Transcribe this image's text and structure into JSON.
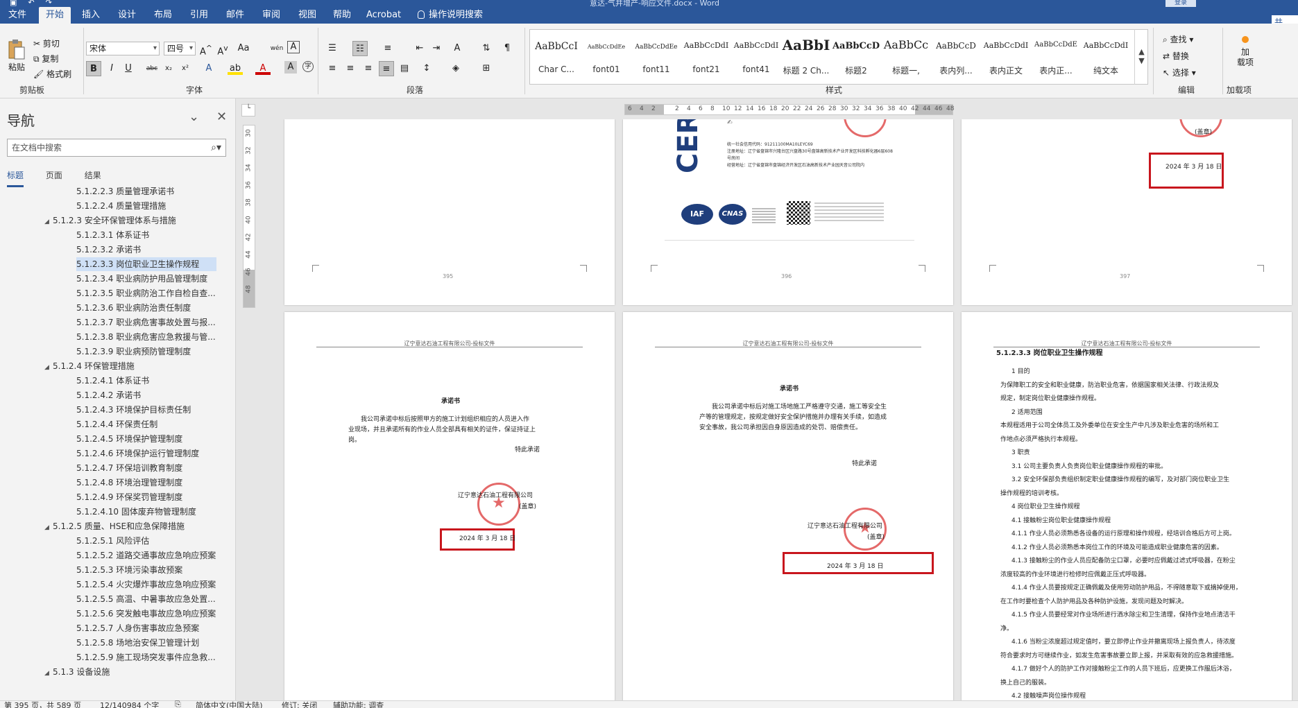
{
  "window": {
    "title": "意达-气井增产-响应文件.docx  -  Word",
    "login_label": "登录"
  },
  "menu": {
    "tabs": [
      {
        "label": "文件"
      },
      {
        "label": "开始"
      },
      {
        "label": "插入"
      },
      {
        "label": "设计"
      },
      {
        "label": "布局"
      },
      {
        "label": "引用"
      },
      {
        "label": "邮件"
      },
      {
        "label": "审阅"
      },
      {
        "label": "视图"
      },
      {
        "label": "帮助"
      },
      {
        "label": "Acrobat"
      }
    ],
    "tell_me": "操作说明搜索",
    "share": "共"
  },
  "ribbon": {
    "clipboard": {
      "paste": "粘贴",
      "cut": "剪切",
      "copy": "复制",
      "format_painter": "格式刷",
      "group": "剪贴板"
    },
    "font": {
      "name": "宋体",
      "size": "四号",
      "group": "字体",
      "case_btn": "Aa",
      "phonetic": "wén",
      "border_char": "A"
    },
    "paragraph": {
      "group": "段落"
    },
    "styles": {
      "group": "样式",
      "items": [
        {
          "preview": "AaBbCcI",
          "name": "Char C..."
        },
        {
          "preview": "AaBbCcDdEe",
          "name": "font01"
        },
        {
          "preview": "AaBbCcDdEe",
          "name": "font11"
        },
        {
          "preview": "AaBbCcDdI",
          "name": "font21"
        },
        {
          "preview": "AaBbCcDdI",
          "name": "font41"
        },
        {
          "preview": "AaBbI",
          "name": "标题 2 Ch..."
        },
        {
          "preview": "AaBbCcD",
          "name": "标题2"
        },
        {
          "preview": "AaBbCc",
          "name": "标题一,"
        },
        {
          "preview": "AaBbCcD",
          "name": "表内列..."
        },
        {
          "preview": "AaBbCcDdI",
          "name": "表内正文"
        },
        {
          "preview": "AaBbCcDdE",
          "name": "表内正..."
        },
        {
          "preview": "AaBbCcDdI",
          "name": "纯文本"
        }
      ]
    },
    "editing": {
      "find": "查找",
      "replace": "替换",
      "select": "选择",
      "group": "编辑"
    },
    "addins": {
      "button": "加\n载项",
      "group": "加载项"
    }
  },
  "nav": {
    "title": "导航",
    "search_placeholder": "在文档中搜索",
    "tabs": [
      "标题",
      "页面",
      "结果"
    ],
    "items": [
      {
        "label": "5.1.2.2.3 质量管理承诺书",
        "level": 3
      },
      {
        "label": "5.1.2.2.4 质量管理措施",
        "level": 3
      },
      {
        "label": "5.1.2.3 安全环保管理体系与措施",
        "level": 2,
        "expanded": true
      },
      {
        "label": "5.1.2.3.1 体系证书",
        "level": 3
      },
      {
        "label": "5.1.2.3.2 承诺书",
        "level": 3
      },
      {
        "label": "5.1.2.3.3 岗位职业卫生操作规程",
        "level": 3,
        "selected": true
      },
      {
        "label": "5.1.2.3.4 职业病防护用品管理制度",
        "level": 3
      },
      {
        "label": "5.1.2.3.5 职业病防治工作自检自查...",
        "level": 3
      },
      {
        "label": "5.1.2.3.6 职业病防治责任制度",
        "level": 3
      },
      {
        "label": "5.1.2.3.7 职业病危害事故处置与报...",
        "level": 3
      },
      {
        "label": "5.1.2.3.8 职业病危害应急救援与管...",
        "level": 3
      },
      {
        "label": "5.1.2.3.9 职业病预防管理制度",
        "level": 3
      },
      {
        "label": "5.1.2.4 环保管理措施",
        "level": 2,
        "expanded": true
      },
      {
        "label": "5.1.2.4.1 体系证书",
        "level": 3
      },
      {
        "label": "5.1.2.4.2 承诺书",
        "level": 3
      },
      {
        "label": "5.1.2.4.3 环境保护目标责任制",
        "level": 3
      },
      {
        "label": "5.1.2.4.4 环保责任制",
        "level": 3
      },
      {
        "label": "5.1.2.4.5 环境保护管理制度",
        "level": 3
      },
      {
        "label": "5.1.2.4.6 环境保护运行管理制度",
        "level": 3
      },
      {
        "label": "5.1.2.4.7 环保培训教育制度",
        "level": 3
      },
      {
        "label": "5.1.2.4.8 环境治理管理制度",
        "level": 3
      },
      {
        "label": "5.1.2.4.9 环保奖罚管理制度",
        "level": 3
      },
      {
        "label": "5.1.2.4.10 固体废弃物管理制度",
        "level": 3
      },
      {
        "label": "5.1.2.5 质量、HSE和应急保障措施",
        "level": 2,
        "expanded": true
      },
      {
        "label": "5.1.2.5.1 风险评估",
        "level": 3
      },
      {
        "label": "5.1.2.5.2 道路交通事故应急响应预案",
        "level": 3
      },
      {
        "label": "5.1.2.5.3 环境污染事故预案",
        "level": 3
      },
      {
        "label": "5.1.2.5.4 火灾爆炸事故应急响应预案",
        "level": 3
      },
      {
        "label": "5.1.2.5.5 高温、中暑事故应急处置...",
        "level": 3
      },
      {
        "label": "5.1.2.5.6 突发触电事故应急响应预案",
        "level": 3
      },
      {
        "label": "5.1.2.5.7 人身伤害事故应急预案",
        "level": 3
      },
      {
        "label": "5.1.2.5.8 场地治安保卫管理计划",
        "level": 3
      },
      {
        "label": "5.1.2.5.9 施工现场突发事件应急救...",
        "level": 3
      },
      {
        "label": "5.1.3 设备设施",
        "level": 1,
        "expanded": true
      }
    ]
  },
  "ruler": {
    "h_ticks": [
      "6",
      "4",
      "2",
      "",
      "2",
      "4",
      "6",
      "8",
      "10",
      "12",
      "14",
      "16",
      "18",
      "20",
      "22",
      "24",
      "26",
      "28",
      "30",
      "32",
      "34",
      "36",
      "38",
      "40",
      "42",
      "44",
      "46",
      "48"
    ],
    "v_ticks": [
      "30",
      "32",
      "34",
      "36",
      "38",
      "40",
      "42",
      "44",
      "46",
      "48"
    ]
  },
  "pages": {
    "p395": {
      "number": "395"
    },
    "p396": {
      "number": "396",
      "cert_text": "CER",
      "cert_lines": [
        "统一社会信用代码：91211100MA10LEYC69",
        "注册地址：辽宁省盘锦市兴隆台区兴盘路30号盘锦高新技术产业开发区科技孵化器6层608",
        "号房间",
        "经营地址：辽宁省盘锦市盘锦经济开发区石油高新技术产业园天音公司院内"
      ],
      "logo1": "IAF",
      "logo2": "CNAS"
    },
    "p397": {
      "number": "397",
      "stamp_note": "(盖章)",
      "date": "2024 年 3 月 18 日"
    },
    "p398": {
      "header": "辽宁意达石油工程有限公司-投标文件",
      "title": "承诺书",
      "body1": "我公司承诺中标后按照甲方的施工计划组织相应的人员进入作",
      "body2": "业现场，并且承诺所有的作业人员全部具有相关的证件，保证持证上",
      "body3": "岗。",
      "sign": "特此承诺",
      "company": "辽宁意达石油工程有限公司",
      "stamp_note": "(盖章)",
      "date": "2024 年 3 月 18 日"
    },
    "p399": {
      "header": "辽宁意达石油工程有限公司-投标文件",
      "title": "承诺书",
      "body1": "我公司承诺中标后对施工场地施工严格遵守交通，施工等安全生",
      "body2": "产等的管理规定，按规定做好安全保护措施并办理有关手续，如造成",
      "body3": "安全事故，我公司承担因自身原因造成的处罚、赔偿责任。",
      "sign": "特此承诺",
      "company": "辽宁意达石油工程有限公司",
      "stamp_note": "(盖章)",
      "date": "2024 年 3 月 18 日"
    },
    "p400": {
      "header": "辽宁意达石油工程有限公司-投标文件",
      "heading": "5.1.2.3.3 岗位职业卫生操作规程",
      "lines": [
        "1 目的",
        "为保障职工的安全和职业健康，防治职业危害，依据国家相关法律、行政法规及",
        "规定，制定岗位职业健康操作规程。",
        "2 适用范围",
        "本规程适用于公司全体员工及外委单位在安全生产中凡涉及职业危害的场所和工",
        "作地点必须严格执行本规程。",
        "3 职责",
        "3.1 公司主要负责人负责岗位职业健康操作规程的审批。",
        "3.2 安全环保部负责组织制定职业健康操作规程的编写，及对部门岗位职业卫生",
        "操作规程的培训考核。",
        "4 岗位职业卫生操作规程",
        "4.1 接触粉尘岗位职业健康操作规程",
        "4.1.1 作业人员必须熟悉各设备的运行原理和操作规程，经培训合格后方可上岗。",
        "4.1.2 作业人员必须熟悉本岗位工作的环境及可能造成职业健康危害的因素。",
        "4.1.3 接触粉尘的作业人员应配备防尘口罩，必要时应佩戴过滤式呼吸器，在粉尘",
        "浓度较高的作业环境进行检修时应佩戴正压式呼吸器。",
        "4.1.4 作业人员要按规定正确佩戴及使用劳动防护用品，不得随意取下或摘掉使用，",
        "在工作时要检查个人防护用品及各种防护设施，发现问题及时解决。",
        "4.1.5 作业人员要经常对作业场所进行洒水除尘和卫生清理，保持作业地点清洁干",
        "净。",
        "4.1.6 当粉尘浓度超过规定值时，要立即停止作业并撤离现场上报负责人，待浓度",
        "符合要求时方可继续作业，如发生危害事故要立即上报，并采取有效的应急救援措施。",
        "4.1.7 做好个人的防护工作对接触粉尘工作的人员下班后，应更换工作服后沐浴，",
        "换上自己的服装。",
        "4.2 接触噪声岗位操作规程"
      ]
    }
  },
  "status": {
    "page": "第 395 页，共 589 页",
    "words": "12/140984 个字",
    "language": "简体中文(中国大陆)",
    "track": "修订: 关闭",
    "accessibility": "辅助功能: 调查"
  }
}
